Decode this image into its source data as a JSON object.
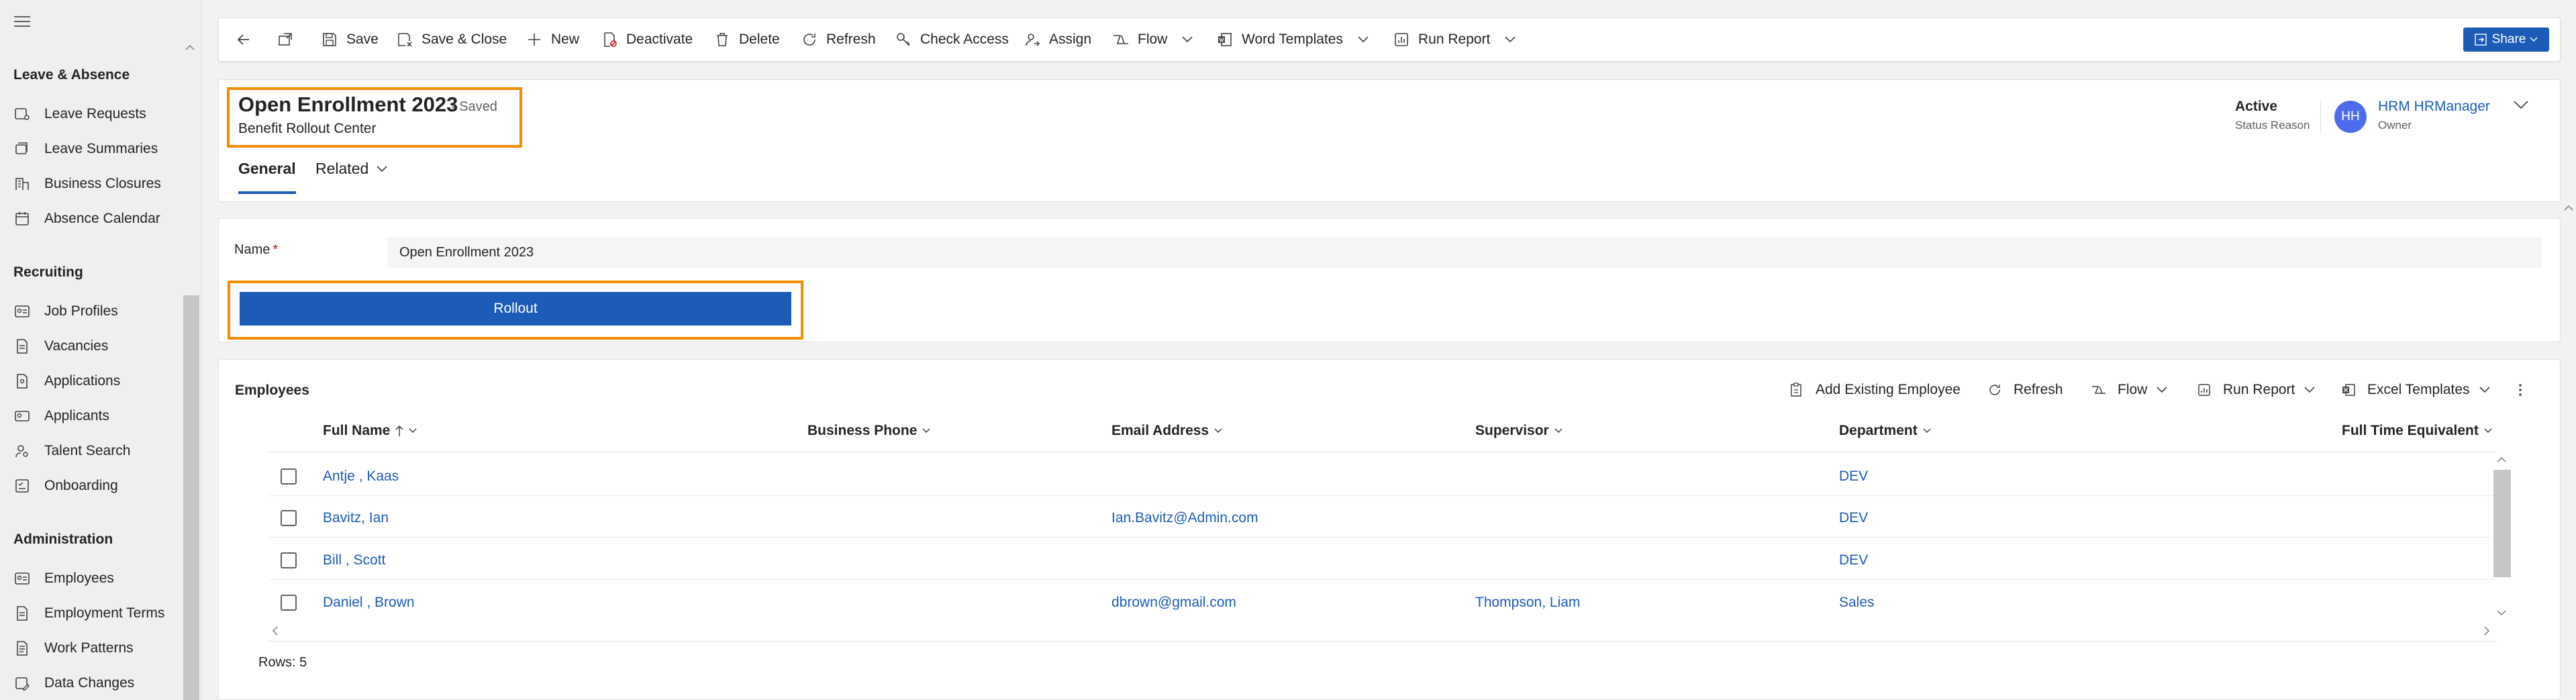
{
  "sidebar": {
    "groups": [
      {
        "title": "Leave & Absence",
        "items": [
          "Leave Requests",
          "Leave Summaries",
          "Business Closures",
          "Absence Calendar"
        ]
      },
      {
        "title": "Recruiting",
        "items": [
          "Job Profiles",
          "Vacancies",
          "Applications",
          "Applicants",
          "Talent Search",
          "Onboarding"
        ]
      },
      {
        "title": "Administration",
        "items": [
          "Employees",
          "Employment Terms",
          "Work Patterns",
          "Data Changes"
        ]
      }
    ]
  },
  "toolbar": {
    "save": "Save",
    "save_close": "Save & Close",
    "new": "New",
    "deactivate": "Deactivate",
    "delete": "Delete",
    "refresh": "Refresh",
    "check_access": "Check Access",
    "assign": "Assign",
    "flow": "Flow",
    "word_templates": "Word Templates",
    "run_report": "Run Report",
    "share": "Share"
  },
  "record": {
    "title": "Open Enrollment 2023",
    "saved_status": "- Saved",
    "entity": "Benefit Rollout Center",
    "tabs": [
      "General",
      "Related"
    ],
    "status_value": "Active",
    "status_label": "Status Reason",
    "owner_initials": "HH",
    "owner_name": "HRM HRManager",
    "owner_label": "Owner"
  },
  "form": {
    "name_label": "Name",
    "required_mark": "*",
    "name_value": "Open Enrollment 2023",
    "rollout_label": "Rollout"
  },
  "grid": {
    "title": "Employees",
    "commands": {
      "add_existing": "Add Existing Employee",
      "refresh": "Refresh",
      "flow": "Flow",
      "run_report": "Run Report",
      "excel_templates": "Excel Templates"
    },
    "columns": [
      "Full Name",
      "Business Phone",
      "Email Address",
      "Supervisor",
      "Department",
      "Full Time Equivalent"
    ],
    "rows": [
      {
        "full_name": "Antje , Kaas",
        "phone": "",
        "email": "",
        "supervisor": "",
        "department": "DEV"
      },
      {
        "full_name": "Bavitz, Ian",
        "phone": "",
        "email": "Ian.Bavitz@Admin.com",
        "supervisor": "",
        "department": "DEV"
      },
      {
        "full_name": "Bill , Scott",
        "phone": "",
        "email": "",
        "supervisor": "",
        "department": "DEV"
      },
      {
        "full_name": "Daniel , Brown",
        "phone": "",
        "email": "dbrown@gmail.com",
        "supervisor": "Thompson, Liam",
        "department": "Sales"
      }
    ],
    "rows_count": "Rows: 5"
  },
  "colors": {
    "accent": "#1c5bb8",
    "highlight": "#f28c00",
    "avatar": "#4f6bed"
  }
}
